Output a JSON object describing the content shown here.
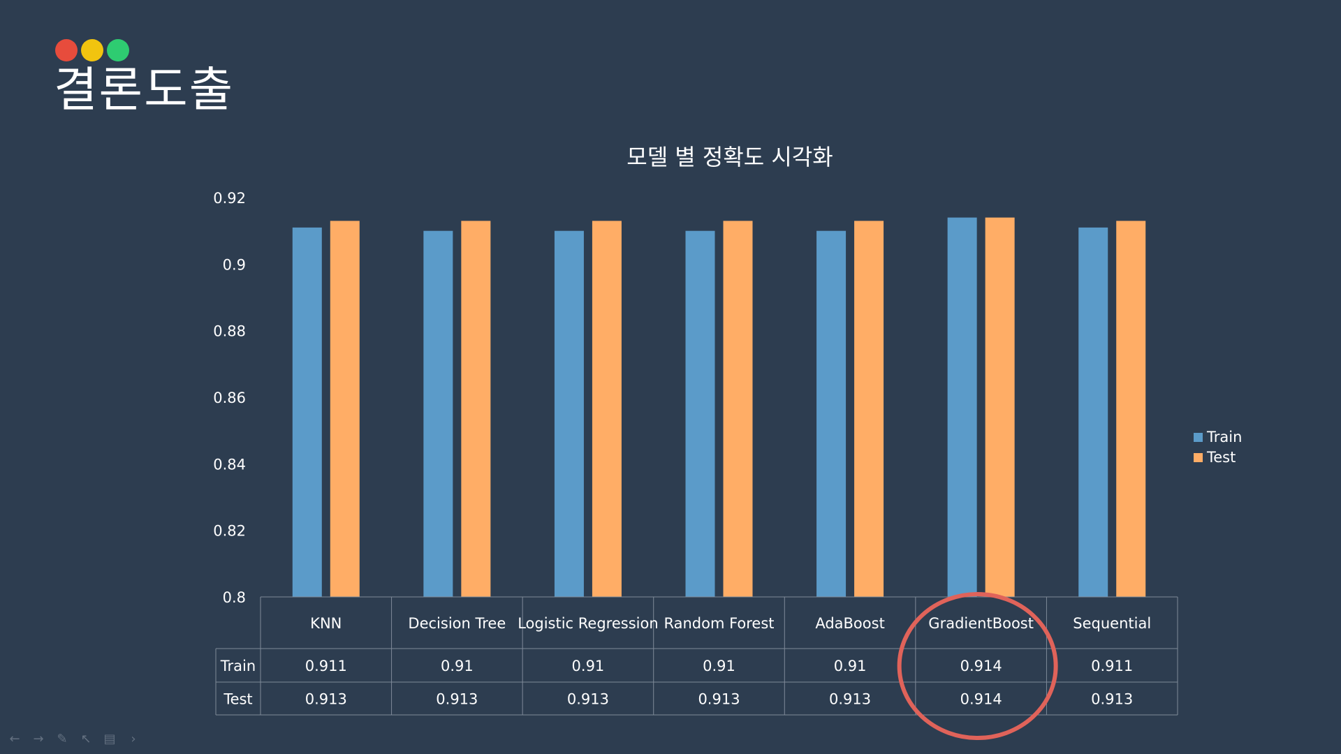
{
  "slide": {
    "title": "결론도출",
    "dots": [
      {
        "name": "red-dot",
        "color": "#e74c3c"
      },
      {
        "name": "yellow-dot",
        "color": "#f1c40f"
      },
      {
        "name": "green-dot",
        "color": "#2ecc71"
      }
    ]
  },
  "nav": {
    "icons": [
      "arrow-left-icon",
      "arrow-right-icon",
      "pen-icon",
      "pointer-icon",
      "slide-menu-icon",
      "chevron-right-icon"
    ]
  },
  "chart_data": {
    "type": "bar",
    "title": "모델 별 정확도 시각화",
    "categories": [
      "KNN",
      "Decision Tree",
      "Logistic Regression",
      "Random Forest",
      "AdaBoost",
      "GradientBoost",
      "Sequential"
    ],
    "series": [
      {
        "name": "Train",
        "color": "#5b9bc9",
        "values": [
          0.911,
          0.91,
          0.91,
          0.91,
          0.91,
          0.914,
          0.911
        ]
      },
      {
        "name": "Test",
        "color": "#ffad66",
        "values": [
          0.913,
          0.913,
          0.913,
          0.913,
          0.913,
          0.914,
          0.913
        ]
      }
    ],
    "table": {
      "rows": [
        {
          "label": "Train",
          "values": [
            "0.911",
            "0.91",
            "0.91",
            "0.91",
            "0.91",
            "0.914",
            "0.911"
          ]
        },
        {
          "label": "Test",
          "values": [
            "0.913",
            "0.913",
            "0.913",
            "0.913",
            "0.913",
            "0.914",
            "0.913"
          ]
        }
      ]
    },
    "ylim": [
      0.8,
      0.92
    ],
    "yticks": [
      "0.92",
      "0.9",
      "0.88",
      "0.86",
      "0.84",
      "0.82",
      "0.8"
    ],
    "legend_position": "right",
    "grid": false,
    "highlight": {
      "category": "GradientBoost",
      "shape": "circle",
      "color": "#e0635a"
    }
  }
}
